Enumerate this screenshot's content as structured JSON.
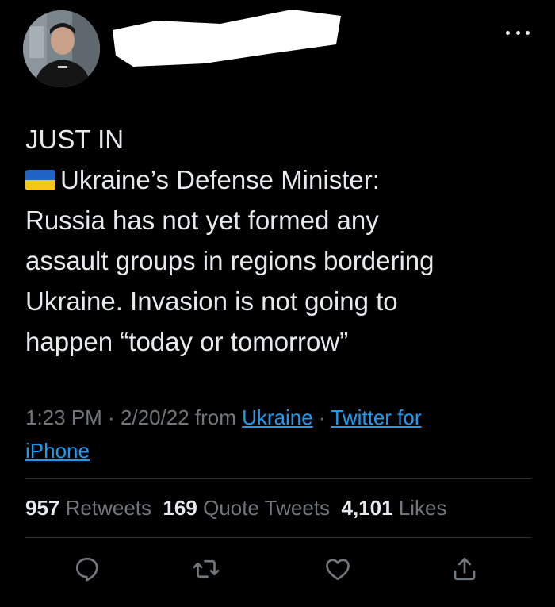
{
  "tweet": {
    "lines": {
      "l1": "JUST IN",
      "l2": "Ukraine’s Defense Minister:",
      "l3": "Russia has not yet formed any",
      "l4": "assault groups in regions bordering",
      "l5": "Ukraine. Invasion is not going to",
      "l6": "happen “today or tomorrow”"
    },
    "flag_icon": "ukraine-flag"
  },
  "meta": {
    "time": "1:23 PM",
    "sep1": " · ",
    "date": "2/20/22",
    "from": " from ",
    "location": "Ukraine",
    "sep2": " · ",
    "source_line1": "Twitter for",
    "source_line2": "iPhone"
  },
  "stats": {
    "retweets_count": "957",
    "retweets_label": "Retweets",
    "quotes_count": "169",
    "quotes_label": "Quote Tweets",
    "likes_count": "4,101",
    "likes_label": "Likes"
  },
  "actions": {
    "reply": "reply-icon",
    "retweet": "retweet-icon",
    "like": "heart-icon",
    "share": "share-icon"
  },
  "colors": {
    "background": "#000000",
    "text": "#e7e9ea",
    "muted": "#71767b",
    "link": "#1d9bf0",
    "divider": "#2f3336"
  }
}
